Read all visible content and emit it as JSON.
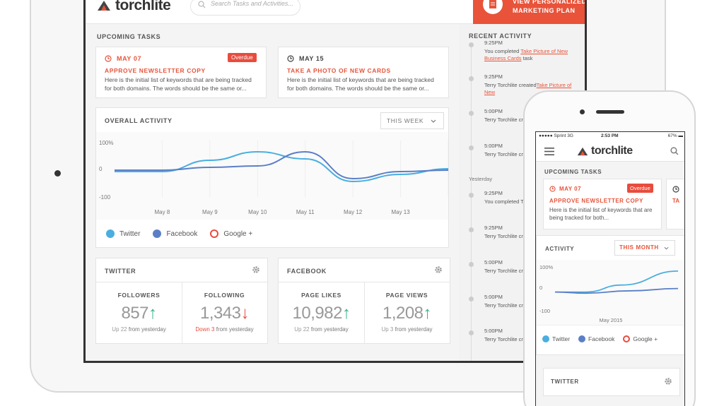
{
  "app": {
    "logo": "torchlite",
    "search_placeholder": "Search Tasks and Activities...",
    "promo": [
      "VIEW PERSONALIZED",
      "MARKETING PLAN"
    ]
  },
  "upcoming": {
    "title": "UPCOMING TASKS",
    "tasks": [
      {
        "date": "MAY 07",
        "badge": "Overdue",
        "title": "APPROVE NEWSLETTER COPY",
        "desc": "Here is the initial list of keywords that are being tracked for both domains. The words should be the same or..."
      },
      {
        "date": "MAY 15",
        "title": "TAKE A PHOTO OF NEW CARDS",
        "desc": "Here is the initial list of keywords that are being tracked for both domains. The words should be the same or..."
      }
    ]
  },
  "activity": {
    "title": "OVERALL ACTIVITY",
    "range": "THIS WEEK",
    "legend": [
      "Twitter",
      "Facebook",
      "Google +"
    ]
  },
  "chart_data": {
    "type": "line",
    "x": [
      "May 8",
      "May 9",
      "May 10",
      "May 11",
      "May 12",
      "May 13"
    ],
    "y_ticks": [
      "100%",
      "0",
      "-100"
    ],
    "ylim": [
      -100,
      100
    ],
    "series": [
      {
        "name": "Twitter",
        "values": [
          -10,
          30,
          60,
          35,
          -45,
          -20
        ]
      },
      {
        "name": "Facebook",
        "values": [
          -5,
          5,
          10,
          60,
          -35,
          -10
        ]
      },
      {
        "name": "Google +",
        "values": []
      }
    ],
    "colors": {
      "Twitter": "#4aaee0",
      "Facebook": "#5b7fc7",
      "Google +": "#e84c3d"
    }
  },
  "twitter": {
    "title": "TWITTER",
    "stats": [
      {
        "label": "FOLLOWERS",
        "value": "857",
        "dir": "up",
        "change": "Up 22",
        "suffix": "from yesterday"
      },
      {
        "label": "FOLLOWING",
        "value": "1,343",
        "dir": "down",
        "change": "Down 3",
        "suffix": "from yesterday"
      }
    ]
  },
  "facebook": {
    "title": "FACEBOOK",
    "stats": [
      {
        "label": "PAGE LIKES",
        "value": "10,982",
        "dir": "up",
        "change": "Up 22",
        "suffix": "from yesterday"
      },
      {
        "label": "PAGE VIEWS",
        "value": "1,208",
        "dir": "up",
        "change": "Up 3",
        "suffix": "from yesterday"
      }
    ]
  },
  "recent": {
    "title": "RECENT ACTIVITY",
    "yesterday_label": "Yesterday",
    "items": [
      {
        "time": "9:25PM",
        "pre": "You completed ",
        "link": "Take Picture of New Business Cards",
        "post": " task"
      },
      {
        "time": "9:25PM",
        "pre": "Terry Torchlite created",
        "link": "Take Picture of New",
        "post": ""
      },
      {
        "time": "5:00PM",
        "pre": "Terry Torchlite create",
        "link": "Take Picture of N",
        "post": ""
      },
      {
        "time": "5:00PM",
        "pre": "Terry Torchlite create",
        "link": "Take Picture of N",
        "post": ""
      },
      {
        "time": "9:25PM",
        "pre": "You completed T",
        "link": "Business Cards",
        "post": ""
      },
      {
        "time": "9:25PM",
        "pre": "Terry Torchlite create",
        "link": "Take Picture of N",
        "post": ""
      },
      {
        "time": "5:00PM",
        "pre": "Terry Torchlite create",
        "link": "Take Picture of N",
        "post": ""
      },
      {
        "time": "5:00PM",
        "pre": "Terry Torchlite create",
        "link": "Take Picture of N",
        "post": ""
      },
      {
        "time": "5:00PM",
        "pre": "Terry Torchlite create",
        "link": "Take Picture of N",
        "post": ""
      },
      {
        "time": "5:00PM",
        "pre": "Terry Torchlite create",
        "link": "Take Picture of N",
        "post": ""
      }
    ]
  },
  "phone": {
    "status": {
      "carrier": "Sprint",
      "net": "3G",
      "time": "2:53 PM",
      "battery": "67%"
    },
    "logo": "torchlite",
    "upcoming_title": "UPCOMING TASKS",
    "task": {
      "date": "MAY 07",
      "badge": "Overdue",
      "title": "APPROVE NEWSLETTER COPY",
      "desc": "Here is the initial list of keywords that are being tracked for both..."
    },
    "task2_title": "TA",
    "activity_title": "ACTIVITY",
    "range": "THIS MONTH",
    "y_ticks": [
      "100%",
      "0",
      "-100"
    ],
    "xlabel": "May 2015",
    "legend": [
      "Twitter",
      "Facebook",
      "Google +"
    ],
    "twitter_title": "TWITTER"
  }
}
